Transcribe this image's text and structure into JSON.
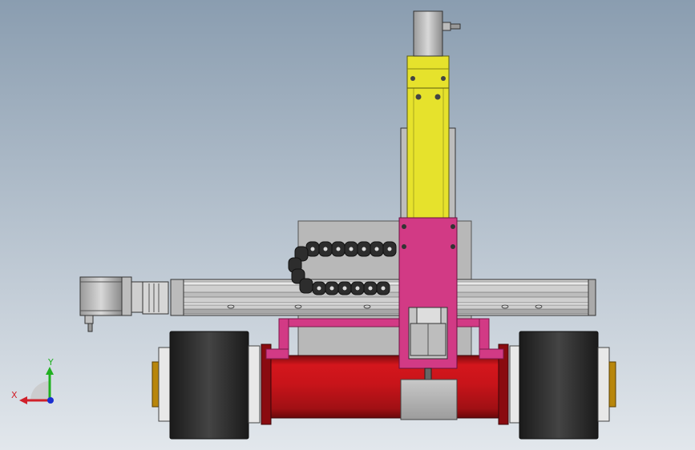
{
  "viewport": {
    "background_top": "#8a9db0",
    "background_bottom": "#dde3ea"
  },
  "colors": {
    "z_axis_yellow": "#e6e22c",
    "carriage_magenta": "#d23a85",
    "base_red": "#c8141a",
    "wheel_dark": "#2e2e2e",
    "frame_grey": "#b9b9b9"
  },
  "triad": {
    "x_label": "X",
    "y_label": "Y",
    "x_color": "#d0202a",
    "y_color": "#20b020",
    "z_color": "#1a2fd0"
  }
}
